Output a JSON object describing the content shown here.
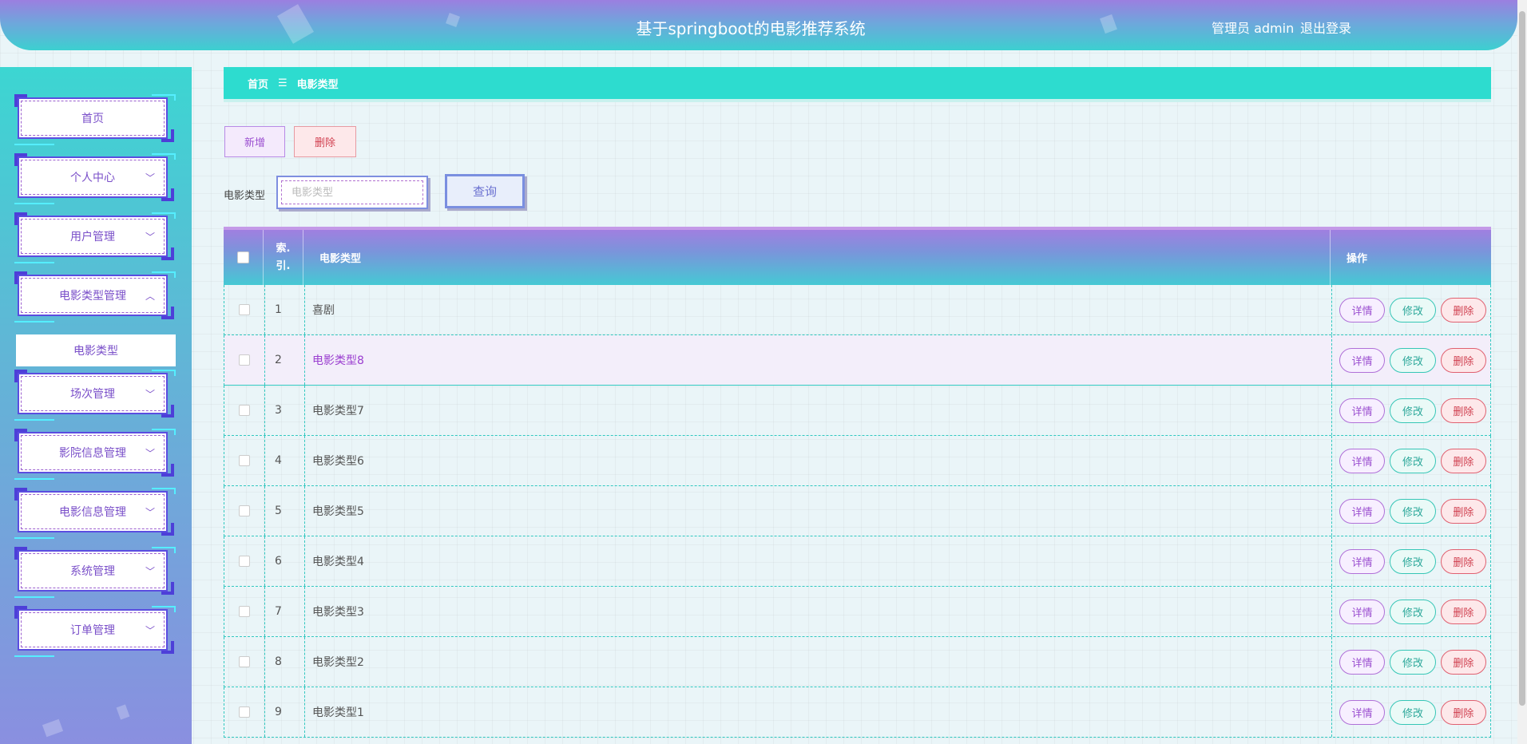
{
  "header": {
    "title": "基于springboot的电影推荐系统",
    "user_label": "管理员 admin",
    "logout_label": "退出登录"
  },
  "sidebar": {
    "items": [
      {
        "label": "首页",
        "has_chevron": false
      },
      {
        "label": "个人中心",
        "has_chevron": true
      },
      {
        "label": "用户管理",
        "has_chevron": true
      },
      {
        "label": "电影类型管理",
        "has_chevron": true,
        "expanded": true
      },
      {
        "label": "场次管理",
        "has_chevron": true
      },
      {
        "label": "影院信息管理",
        "has_chevron": true
      },
      {
        "label": "电影信息管理",
        "has_chevron": true
      },
      {
        "label": "系统管理",
        "has_chevron": true
      },
      {
        "label": "订单管理",
        "has_chevron": true
      }
    ],
    "submenu_label": "电影类型"
  },
  "breadcrumb": {
    "home": "首页",
    "separator": "☰",
    "current": "电影类型"
  },
  "actions": {
    "add_label": "新增",
    "delete_label": "删除"
  },
  "search": {
    "label": "电影类型",
    "placeholder": "电影类型",
    "button_label": "查询"
  },
  "table": {
    "headers": {
      "index_line1": "索.",
      "index_line2": "引.",
      "type": "电影类型",
      "ops": "操作"
    },
    "rows": [
      {
        "index": "1",
        "type": "喜剧"
      },
      {
        "index": "2",
        "type": "电影类型8"
      },
      {
        "index": "3",
        "type": "电影类型7"
      },
      {
        "index": "4",
        "type": "电影类型6"
      },
      {
        "index": "5",
        "type": "电影类型5"
      },
      {
        "index": "6",
        "type": "电影类型4"
      },
      {
        "index": "7",
        "type": "电影类型3"
      },
      {
        "index": "8",
        "type": "电影类型2"
      },
      {
        "index": "9",
        "type": "电影类型1"
      }
    ],
    "ops": {
      "detail": "详情",
      "edit": "修改",
      "delete": "删除"
    }
  },
  "colors": {
    "accent_teal": "#2ddccf",
    "accent_purple": "#9b7fe0"
  }
}
